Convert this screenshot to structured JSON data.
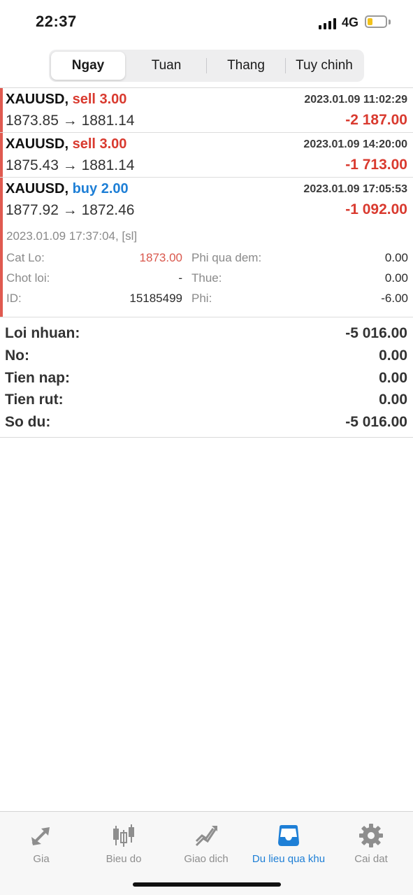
{
  "status_bar": {
    "time": "22:37",
    "network": "4G"
  },
  "segments": [
    "Ngay",
    "Tuan",
    "Thang",
    "Tuy chinh"
  ],
  "active_segment": "Ngay",
  "deals": [
    {
      "symbol": "XAUUSD,",
      "side": "sell 3.00",
      "side_type": "sell",
      "time": "2023.01.09 11:02:29",
      "prices": "1873.85 → 1881.14",
      "profit": "-2 187.00"
    },
    {
      "symbol": "XAUUSD,",
      "side": "sell 3.00",
      "side_type": "sell",
      "time": "2023.01.09 14:20:00",
      "prices": "1875.43 → 1881.14",
      "profit": "-1 713.00"
    },
    {
      "symbol": "XAUUSD,",
      "side": "buy 2.00",
      "side_type": "buy",
      "time": "2023.01.09 17:05:53",
      "prices": "1877.92 → 1872.46",
      "profit": "-1 092.00"
    }
  ],
  "deal_detail": {
    "close_line": "2023.01.09 17:37:04, [sl]",
    "stop_loss_label": "Cat Lo:",
    "stop_loss_value": "1873.00",
    "take_profit_label": "Chot loi:",
    "take_profit_value": "-",
    "id_label": "ID:",
    "id_value": "15185499",
    "swap_label": "Phi qua dem:",
    "swap_value": "0.00",
    "tax_label": "Thue:",
    "tax_value": "0.00",
    "fee_label": "Phi:",
    "fee_value": "-6.00"
  },
  "summary": [
    {
      "label": "Loi nhuan:",
      "value": "-5 016.00"
    },
    {
      "label": "No:",
      "value": "0.00"
    },
    {
      "label": "Tien nap:",
      "value": "0.00"
    },
    {
      "label": "Tien rut:",
      "value": "0.00"
    },
    {
      "label": "So du:",
      "value": "-5 016.00"
    }
  ],
  "tabs": [
    {
      "label": "Gia",
      "icon": "price-arrows-icon"
    },
    {
      "label": "Bieu do",
      "icon": "candlestick-chart-icon"
    },
    {
      "label": "Giao dich",
      "icon": "trade-chart-icon"
    },
    {
      "label": "Du lieu qua khu",
      "icon": "history-inbox-icon"
    },
    {
      "label": "Cai dat",
      "icon": "gear-icon"
    }
  ],
  "active_tab": "Du lieu qua khu",
  "colors": {
    "sell": "#d93a2f",
    "buy": "#1e7fd6",
    "accent": "#1e7fd6",
    "row_marker": "#e05a50",
    "inactive_icon": "#8e8e8e"
  }
}
